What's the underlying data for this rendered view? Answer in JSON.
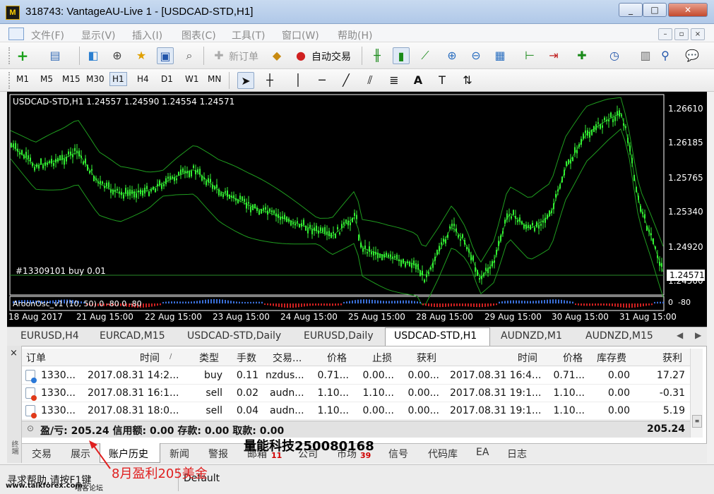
{
  "window": {
    "title": "318743: VantageAU-Live 1 - [USDCAD-STD,H1]",
    "buttons": [
      "_",
      "□",
      "✕"
    ]
  },
  "menu": [
    "文件(F)",
    "显示(V)",
    "插入(I)",
    "图表(C)",
    "工具(T)",
    "窗口(W)",
    "帮助(H)"
  ],
  "toolbar": {
    "new_order": "新订单",
    "auto_trade": "自动交易"
  },
  "timeframes": [
    "M1",
    "M5",
    "M15",
    "M30",
    "H1",
    "H4",
    "D1",
    "W1",
    "MN"
  ],
  "timeframe_selected": "H1",
  "chart": {
    "header": "USDCAD-STD,H1  1.24557 1.24590 1.24554 1.24571",
    "order_line": "#13309101 buy 0.01",
    "oscillator": "AroonOsc_v1 (10, 50) 0 -80 0 -80",
    "current_price": "1.24571",
    "price_ticks": [
      "1.26610",
      "1.26185",
      "1.25765",
      "1.25340",
      "1.24920",
      "1.24500"
    ],
    "osc_ticks": [
      "0",
      "-80"
    ],
    "time_ticks": [
      "18 Aug 2017",
      "21 Aug 15:00",
      "22 Aug 15:00",
      "23 Aug 15:00",
      "24 Aug 15:00",
      "25 Aug 15:00",
      "28 Aug 15:00",
      "29 Aug 15:00",
      "30 Aug 15:00",
      "31 Aug 15:00"
    ],
    "colors": {
      "bg": "#000000",
      "candle": "#33ee33",
      "bands": "#1f9c1f",
      "osc_up": "#3a6fd8",
      "osc_down": "#d02020"
    }
  },
  "chart_tabs": [
    "EURUSD,H4",
    "EURCAD,M15",
    "USDCAD-STD,Daily",
    "EURUSD,Daily",
    "USDCAD-STD,H1",
    "AUDNZD,M1",
    "AUDNZD,M15"
  ],
  "chart_tab_selected": "USDCAD-STD,H1",
  "terminal": {
    "columns": [
      "订单",
      "时间",
      "类型",
      "手数",
      "交易...",
      "价格",
      "止损",
      "获利",
      "时间",
      "价格",
      "库存费",
      "获利"
    ],
    "rows": [
      {
        "order": "1330...",
        "open_time": "2017.08.31 14:2...",
        "type": "buy",
        "lots": "0.11",
        "symbol": "nzdus...",
        "price": "0.71...",
        "sl": "0.00...",
        "tp": "0.00...",
        "close_time": "2017.08.31 16:4...",
        "close_price": "0.71...",
        "swap": "0.00",
        "profit": "17.27"
      },
      {
        "order": "1330...",
        "open_time": "2017.08.31 16:1...",
        "type": "sell",
        "lots": "0.02",
        "symbol": "audn...",
        "price": "1.10...",
        "sl": "1.10...",
        "tp": "0.00...",
        "close_time": "2017.08.31 19:1...",
        "close_price": "1.10...",
        "swap": "0.00",
        "profit": "-0.31"
      },
      {
        "order": "1330...",
        "open_time": "2017.08.31 18:0...",
        "type": "sell",
        "lots": "0.04",
        "symbol": "audn...",
        "price": "1.10...",
        "sl": "0.00...",
        "tp": "0.00...",
        "close_time": "2017.08.31 19:1...",
        "close_price": "1.10...",
        "swap": "0.00",
        "profit": "5.19"
      }
    ],
    "summary": "盈/亏: 205.24 信用额: 0.00 存款: 0.00 取款: 0.00",
    "summary_total": "205.24",
    "tabs": [
      "交易",
      "展示",
      "账户历史",
      "新闻",
      "警报",
      "邮箱",
      "公司",
      "市场",
      "信号",
      "代码库",
      "EA",
      "日志"
    ],
    "tab_selected": "账户历史",
    "mail_badge": "11",
    "market_badge": "39",
    "side_label": "终端"
  },
  "status": {
    "help": "寻求帮助,请按F1键",
    "profile": "Default"
  },
  "overlay": {
    "watermark_top": "量能科技250080168",
    "annotation": "8月盈利205美金",
    "site": "www.talkforex.com",
    "site_cn": "嘻客论坛"
  }
}
